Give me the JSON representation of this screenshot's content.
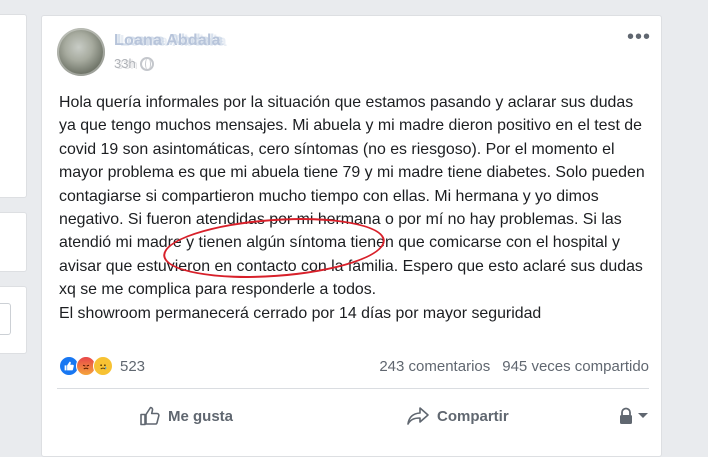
{
  "post": {
    "author": "Loana Abdala",
    "timestamp": "33h",
    "body": [
      "Hola quería informales por la situación que estamos pasando y aclarar sus dudas ya que tengo muchos mensajes. Mi abuela y mi madre dieron positivo en el test de covid 19 son asintomáticas, cero síntomas (no es riesgoso). Por el momento el mayor problema es que mi abuela tiene 79 y mi madre tiene diabetes. Solo pueden contagiarse si compartieron mucho tiempo con ellas. Mi hermana y yo dimos negativo. Si fueron atendidas por mi hermana o por mí no hay problemas. Si las atendió mi madre y tienen algún síntoma tienen que comicarse con el hospital y avisar que estuvieron en contacto con la familia. Espero que esto aclaré sus dudas xq se me complica para responderle a todos.",
      "El showroom permanecerá cerrado por 14 días por mayor seguridad"
    ],
    "more_label": "•••"
  },
  "stats": {
    "reactions_count": "523",
    "comments": "243 comentarios",
    "shares": "945 veces compartido"
  },
  "actions": {
    "like": "Me gusta",
    "share": "Compartir"
  },
  "colors": {
    "brand": "#1877f2",
    "annotation": "#d8202a"
  },
  "icons": [
    "globe-icon",
    "like-icon",
    "share-icon",
    "lock-icon",
    "chevron-down-icon"
  ]
}
